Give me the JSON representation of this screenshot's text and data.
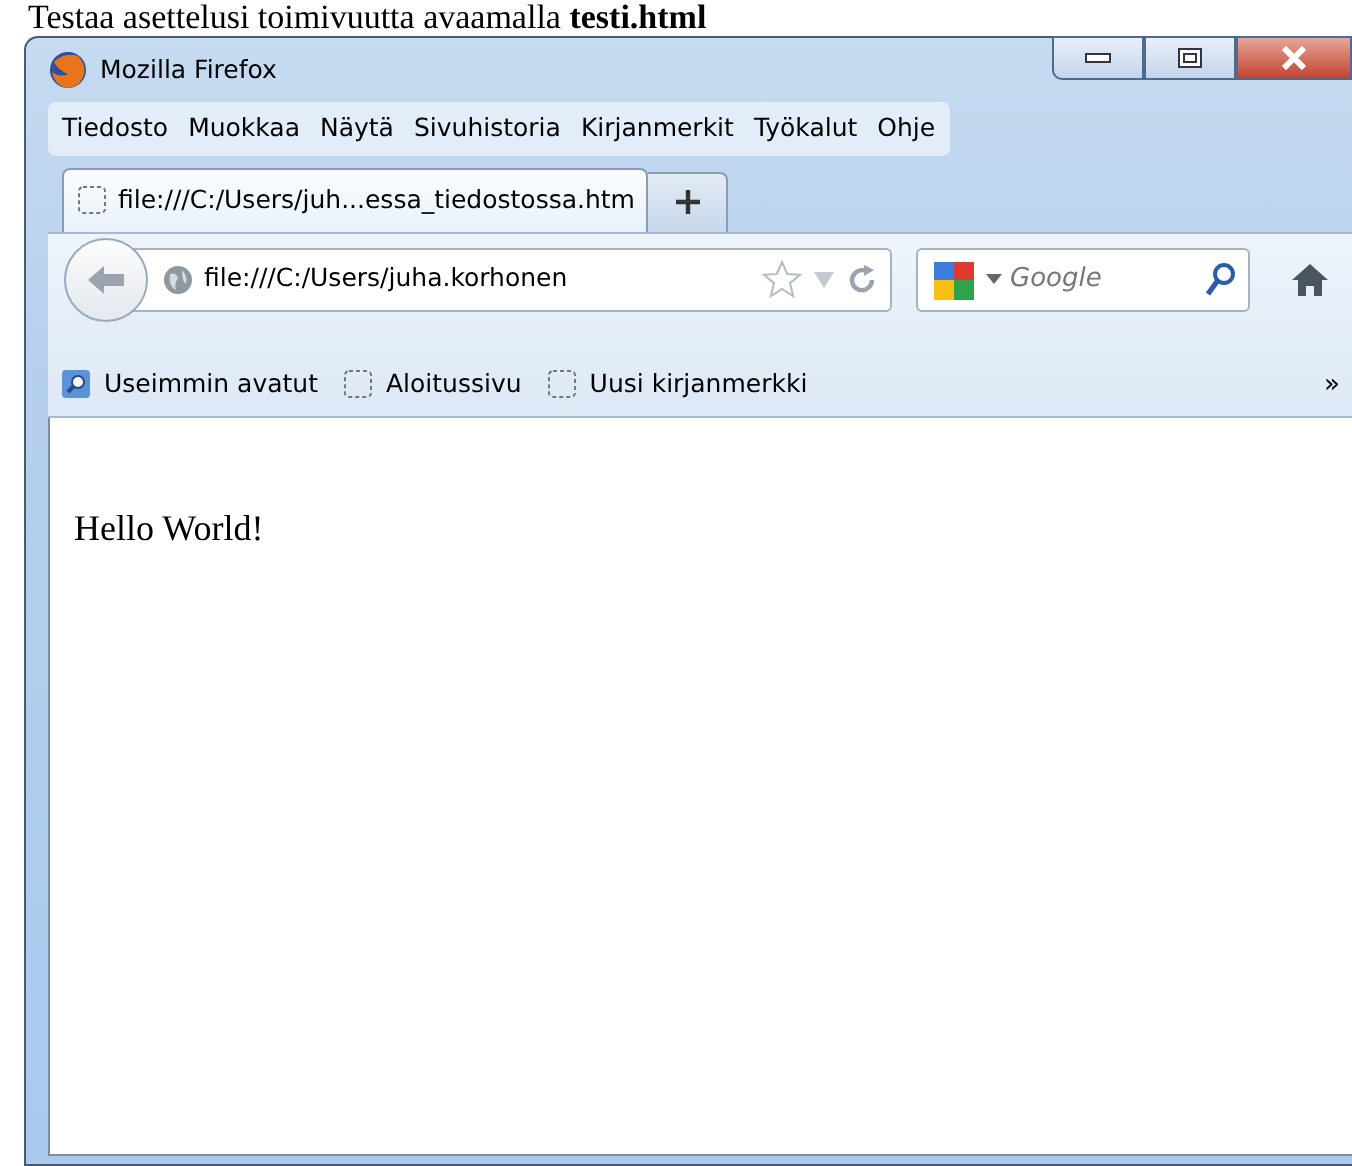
{
  "caption": "Testaa asettelusi toimivuutta avaamalla **testi.html**",
  "window": {
    "title": "Mozilla Firefox"
  },
  "menu": [
    {
      "label": "Tiedosto"
    },
    {
      "label": "Muokkaa"
    },
    {
      "label": "Näytä"
    },
    {
      "label": "Sivuhistoria"
    },
    {
      "label": "Kirjanmerkit"
    },
    {
      "label": "Työkalut"
    },
    {
      "label": "Ohje"
    }
  ],
  "tabs": [
    {
      "label": "file:///C:/Users/juh...essa_tiedostossa.htm",
      "selected": true
    }
  ],
  "address_bar": {
    "value": "file:///C:/Users/juha.korhonen"
  },
  "search": {
    "placeholder": "Google"
  },
  "bookmarks": [
    {
      "label": "Useimmin avatut",
      "kind": "folder"
    },
    {
      "label": "Aloitussivu",
      "kind": "page"
    },
    {
      "label": "Uusi kirjanmerkki",
      "kind": "page"
    }
  ],
  "bookmarks_overflow": "»",
  "page": {
    "text": "Hello World!"
  }
}
